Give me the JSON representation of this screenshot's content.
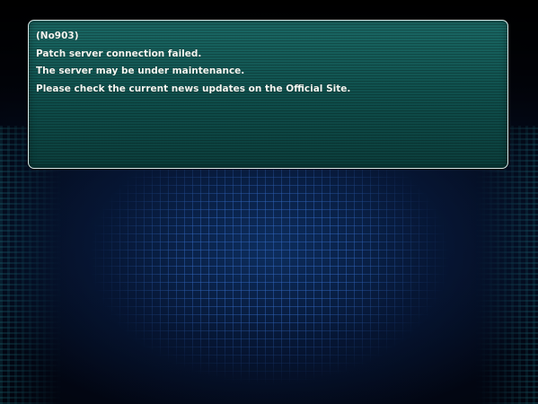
{
  "dialog": {
    "error_code": "(No903)",
    "lines": [
      "Patch server connection failed.",
      "The server may be under maintenance.",
      "Please check the current news updates on the Official Site."
    ]
  },
  "colors": {
    "panel_fill": "#0f4a48",
    "panel_border": "#d8e8e8",
    "text": "#f4f7f2",
    "background_grid": "#3c78dc"
  }
}
